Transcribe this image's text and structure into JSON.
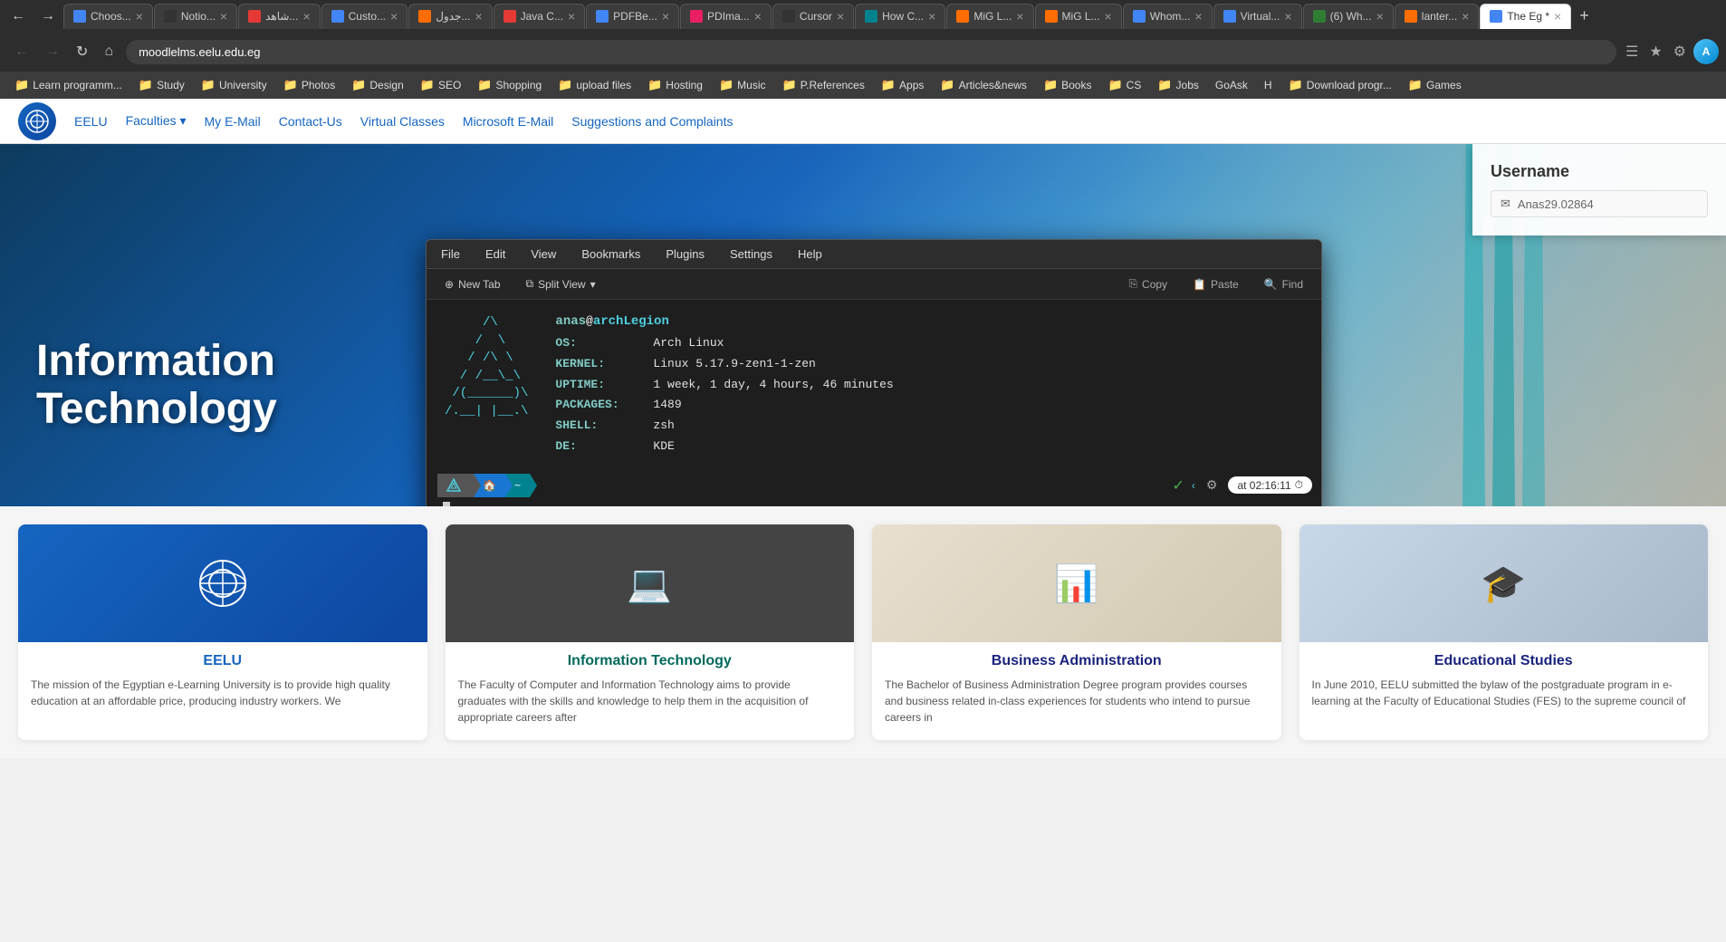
{
  "browser": {
    "tabs": [
      {
        "id": "t1",
        "label": "Choos...",
        "favicon": "blue",
        "active": false
      },
      {
        "id": "t2",
        "label": "Notio...",
        "favicon": "dark",
        "active": false
      },
      {
        "id": "t3",
        "label": "شاهد...",
        "favicon": "red",
        "active": false
      },
      {
        "id": "t4",
        "label": "Custo...",
        "favicon": "blue",
        "active": false
      },
      {
        "id": "t5",
        "label": "جدول...",
        "favicon": "orange",
        "active": false
      },
      {
        "id": "t6",
        "label": "Java C...",
        "favicon": "red",
        "active": false
      },
      {
        "id": "t7",
        "label": "PDFBe...",
        "favicon": "blue",
        "active": false
      },
      {
        "id": "t8",
        "label": "PDIma...",
        "favicon": "pink",
        "active": false
      },
      {
        "id": "t9",
        "label": "Cursor",
        "favicon": "dark",
        "active": false
      },
      {
        "id": "t10",
        "label": "How C...",
        "favicon": "teal",
        "active": false
      },
      {
        "id": "t11",
        "label": "MiG L...",
        "favicon": "orange",
        "active": false
      },
      {
        "id": "t12",
        "label": "MiG L...",
        "favicon": "orange",
        "active": false
      },
      {
        "id": "t13",
        "label": "Whom...",
        "favicon": "blue",
        "active": false
      },
      {
        "id": "t14",
        "label": "Virtual...",
        "favicon": "blue",
        "active": false
      },
      {
        "id": "t15",
        "label": "(6) Wh...",
        "favicon": "green",
        "active": false
      },
      {
        "id": "t16",
        "label": "lanter...",
        "favicon": "orange",
        "active": false
      },
      {
        "id": "t17",
        "label": "The Eg *",
        "favicon": "blue",
        "active": true
      }
    ],
    "url": "moodlelms.eelu.edu.eg",
    "bookmarks": [
      {
        "label": "Learn programm...",
        "type": "folder"
      },
      {
        "label": "Study",
        "type": "folder"
      },
      {
        "label": "University",
        "type": "folder"
      },
      {
        "label": "Photos",
        "type": "folder"
      },
      {
        "label": "Design",
        "type": "folder"
      },
      {
        "label": "SEO",
        "type": "folder"
      },
      {
        "label": "Shopping",
        "type": "folder"
      },
      {
        "label": "upload files",
        "type": "folder"
      },
      {
        "label": "Hosting",
        "type": "folder"
      },
      {
        "label": "Music",
        "type": "folder"
      },
      {
        "label": "P.References",
        "type": "folder"
      },
      {
        "label": "Apps",
        "type": "folder"
      },
      {
        "label": "Articles&news",
        "type": "folder"
      },
      {
        "label": "Books",
        "type": "folder"
      },
      {
        "label": "CS",
        "type": "folder"
      },
      {
        "label": "Jobs",
        "type": "folder"
      },
      {
        "label": "GoAsk",
        "type": "folder"
      },
      {
        "label": "H",
        "type": "folder"
      },
      {
        "label": "Download progr...",
        "type": "folder"
      },
      {
        "label": "Games",
        "type": "folder"
      }
    ]
  },
  "site": {
    "logo_text": "EELU",
    "nav_items": [
      "EELU",
      "Faculties ▾",
      "My E-Mail",
      "Contact-Us",
      "Virtual Classes",
      "Microsoft E-Mail",
      "Suggestions and Complaints"
    ],
    "hero_title_line1": "Information",
    "hero_title_line2": "Technology",
    "login": {
      "title": "Username",
      "placeholder": "Anas29.02864"
    }
  },
  "terminal": {
    "menu_items": [
      "File",
      "Edit",
      "View",
      "Bookmarks",
      "Plugins",
      "Settings",
      "Help"
    ],
    "toolbar": {
      "new_tab": "New Tab",
      "split_view": "Split View",
      "copy": "Copy",
      "paste": "Paste",
      "find": "Find"
    },
    "ascii_art": "     /\\\n    /  \\\n   / /\\ \\\n  / /__\\ \\\n /(______)\\\n/.__| |__.\\",
    "username": "anas",
    "hostname": "archLegion",
    "sysinfo": [
      {
        "key": "OS:",
        "val": "Arch Linux"
      },
      {
        "key": "KERNEL:",
        "val": "Linux 5.17.9-zen1-1-zen"
      },
      {
        "key": "UPTIME:",
        "val": "1 week, 1 day, 4 hours, 46 minutes"
      },
      {
        "key": "PACKAGES:",
        "val": "1489"
      },
      {
        "key": "SHELL:",
        "val": "zsh"
      },
      {
        "key": "DE:",
        "val": "KDE"
      }
    ],
    "time": "at 02:16:11"
  },
  "cards": [
    {
      "id": "eelu",
      "title": "EELU",
      "title_color": "blue",
      "img_class": "eelu",
      "text": "The mission of the Egyptian e-Learning University is to provide high quality education at an affordable price, producing industry workers. We"
    },
    {
      "id": "it",
      "title": "Information Technology",
      "title_color": "teal",
      "img_class": "it",
      "text": "The Faculty of Computer and Information Technology aims to provide graduates with the skills and knowledge to help them in the acquisition of appropriate careers after"
    },
    {
      "id": "ba",
      "title": "Business Administration",
      "title_color": "darkblue",
      "img_class": "ba",
      "text": "The Bachelor of Business Administration Degree program provides courses and business related in-class experiences for students who intend to pursue careers in"
    },
    {
      "id": "es",
      "title": "Educational Studies",
      "title_color": "darkblue",
      "img_class": "es",
      "text": "In June 2010, EELU submitted the bylaw of the postgraduate program in e-learning at the Faculty of Educational Studies (FES) to the supreme council of"
    }
  ]
}
